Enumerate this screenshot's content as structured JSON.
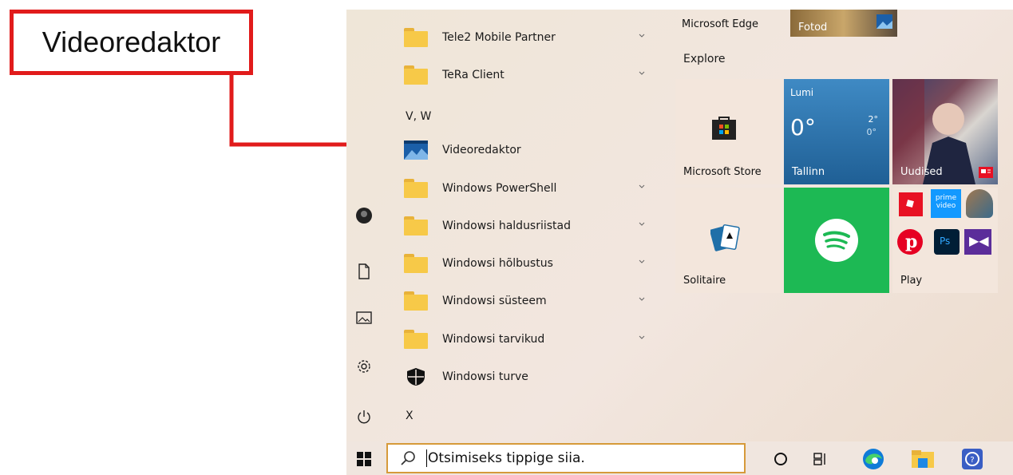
{
  "callout": {
    "text": "Videoredaktor"
  },
  "app_list": {
    "items": [
      {
        "label": "Tele2 Mobile Partner",
        "kind": "folder",
        "expandable": true
      },
      {
        "label": "TeRa Client",
        "kind": "folder",
        "expandable": true
      },
      {
        "label": "Videoredaktor",
        "kind": "app",
        "expandable": false
      },
      {
        "label": "Windows PowerShell",
        "kind": "folder",
        "expandable": true
      },
      {
        "label": "Windowsi haldusriistad",
        "kind": "folder",
        "expandable": true
      },
      {
        "label": "Windowsi hõlbustus",
        "kind": "folder",
        "expandable": true
      },
      {
        "label": "Windowsi süsteem",
        "kind": "folder",
        "expandable": true
      },
      {
        "label": "Windowsi tarvikud",
        "kind": "folder",
        "expandable": true
      },
      {
        "label": "Windowsi turve",
        "kind": "app",
        "expandable": false
      }
    ],
    "section_vw": "V, W",
    "section_x": "X"
  },
  "tiles": {
    "edge_label": "Microsoft Edge",
    "photos_label": "Fotod",
    "explore_header": "Explore",
    "store_label": "Microsoft Store",
    "weather": {
      "condition": "Lumi",
      "temp": "0°",
      "high": "2°",
      "low": "0°",
      "city": "Tallinn"
    },
    "news_label": "Uudised",
    "solitaire_label": "Solitaire",
    "play_label": "Play",
    "prime_text": "prime video",
    "ps_text": "Ps"
  },
  "taskbar": {
    "search_placeholder": "Otsimiseks tippige siia."
  },
  "colors": {
    "accent_red": "#e11b1b",
    "spotify_green": "#1db954",
    "weather_blue": "#1f6fa8"
  }
}
